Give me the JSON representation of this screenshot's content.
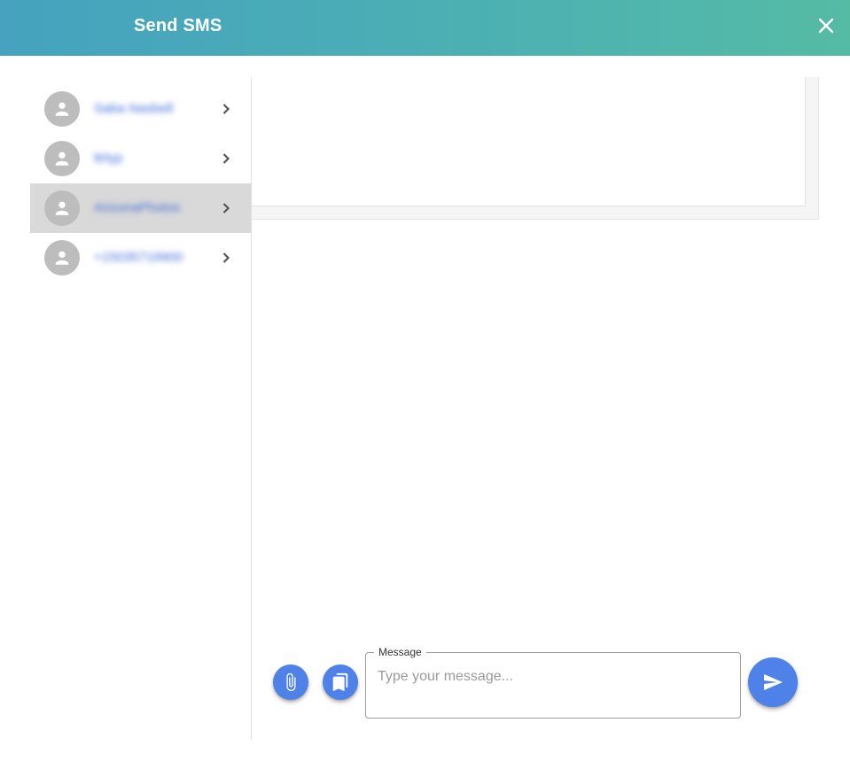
{
  "header": {
    "title": "Send SMS",
    "close_icon": "close-icon",
    "gradient_colors": [
      "#46a2bf",
      "#55bba5"
    ]
  },
  "sidebar": {
    "contacts": [
      {
        "name": "Saba Nasbell",
        "selected": false,
        "icon": "person-icon"
      },
      {
        "name": "ttrlyp",
        "selected": false,
        "icon": "person-icon"
      },
      {
        "name": "ArizonaPhotos",
        "selected": true,
        "icon": "person-icon"
      },
      {
        "name": "+15035719900",
        "selected": false,
        "icon": "person-icon"
      }
    ]
  },
  "composer": {
    "label": "Message",
    "placeholder": "Type your message...",
    "attach_icon": "paperclip-icon",
    "template_icon": "bookmarks-icon",
    "send_icon": "send-icon",
    "accent_color": "#4f82e8"
  }
}
